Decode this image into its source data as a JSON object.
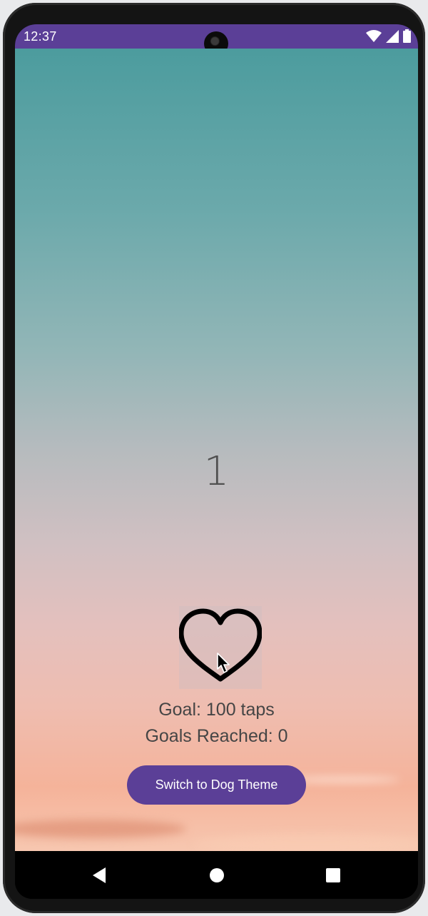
{
  "status_bar": {
    "time": "12:37",
    "icons": [
      "wifi-icon",
      "signal-icon",
      "battery-icon"
    ],
    "background_color": "#5b3f97"
  },
  "main": {
    "counter": "1",
    "heart_icon": "heart-outline-icon",
    "goal_text": "Goal: 100 taps",
    "goals_reached_text": "Goals Reached: 0",
    "theme_button_label": "Switch to Dog Theme",
    "accent_color": "#5b3f97"
  },
  "nav_bar": {
    "buttons": [
      "back-icon",
      "home-icon",
      "recents-icon"
    ]
  }
}
